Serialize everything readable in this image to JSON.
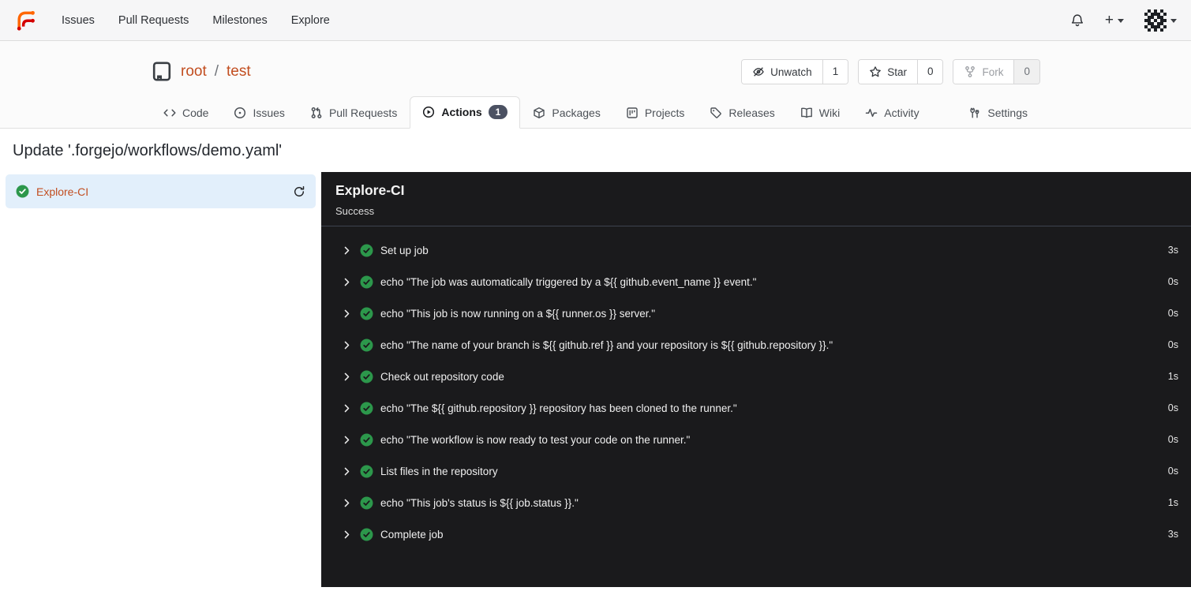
{
  "navbar": {
    "items": [
      {
        "label": "Issues"
      },
      {
        "label": "Pull Requests"
      },
      {
        "label": "Milestones"
      },
      {
        "label": "Explore"
      }
    ]
  },
  "repo": {
    "owner": "root",
    "separator": "/",
    "name": "test",
    "buttons": [
      {
        "label": "Unwatch",
        "count": "1"
      },
      {
        "label": "Star",
        "count": "0"
      },
      {
        "label": "Fork",
        "count": "0",
        "disabled": true
      }
    ]
  },
  "tabs": [
    {
      "label": "Code"
    },
    {
      "label": "Issues"
    },
    {
      "label": "Pull Requests"
    },
    {
      "label": "Actions",
      "badge": "1",
      "active": true
    },
    {
      "label": "Packages"
    },
    {
      "label": "Projects"
    },
    {
      "label": "Releases"
    },
    {
      "label": "Wiki"
    },
    {
      "label": "Activity"
    },
    {
      "label": "Settings"
    }
  ],
  "page": {
    "title": "Update '.forgejo/workflows/demo.yaml'"
  },
  "sidebar": {
    "job": {
      "name": "Explore-CI"
    }
  },
  "run_panel": {
    "title": "Explore-CI",
    "status": "Success",
    "steps": [
      {
        "name": "Set up job",
        "duration": "3s"
      },
      {
        "name": "echo \"The job was automatically triggered by a ${{ github.event_name }} event.\"",
        "duration": "0s"
      },
      {
        "name": "echo \"This job is now running on a ${{ runner.os }} server.\"",
        "duration": "0s"
      },
      {
        "name": "echo \"The name of your branch is ${{ github.ref }} and your repository is ${{ github.repository }}.\"",
        "duration": "0s"
      },
      {
        "name": "Check out repository code",
        "duration": "1s"
      },
      {
        "name": "echo \"The ${{ github.repository }} repository has been cloned to the runner.\"",
        "duration": "0s"
      },
      {
        "name": "echo \"The workflow is now ready to test your code on the runner.\"",
        "duration": "0s"
      },
      {
        "name": "List files in the repository",
        "duration": "0s"
      },
      {
        "name": "echo \"This job's status is ${{ job.status }}.\"",
        "duration": "1s"
      },
      {
        "name": "Complete job",
        "duration": "3s"
      }
    ]
  },
  "colors": {
    "accent_orange": "#c24e20",
    "success_green": "#2c974b",
    "dark_panel_bg": "#1a1a1c",
    "selected_job_bg": "#e2effb",
    "badge_bg": "#4b5162"
  }
}
